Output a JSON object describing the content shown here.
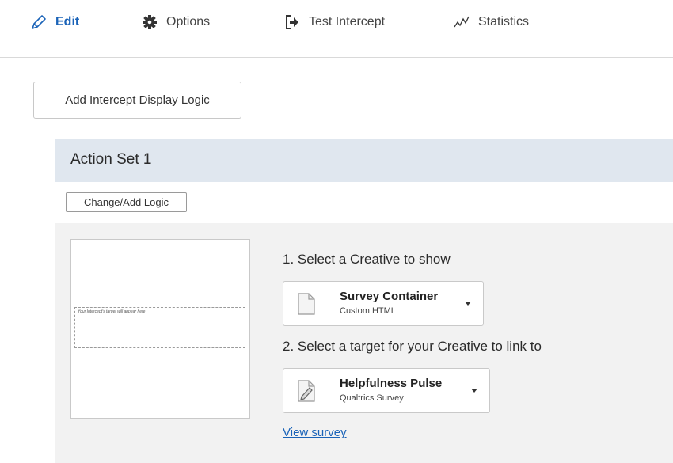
{
  "nav": {
    "edit": "Edit",
    "options": "Options",
    "test_intercept": "Test Intercept",
    "statistics": "Statistics"
  },
  "display_logic_button": "Add Intercept Display Logic",
  "action_set": {
    "title": "Action Set 1",
    "change_logic_button": "Change/Add Logic",
    "preview_target_text": "Your Intercept's target will appear here",
    "step1_label": "1. Select a Creative to show",
    "creative": {
      "title": "Survey Container",
      "subtitle": "Custom HTML"
    },
    "step2_label": "2. Select a target for your Creative to link to",
    "target": {
      "title": "Helpfulness Pulse",
      "subtitle": "Qualtrics Survey"
    },
    "view_link": "View survey"
  },
  "colors": {
    "accent": "#1a63b8",
    "header_bg": "#e0e7ef",
    "panel_bg": "#f2f2f2"
  }
}
